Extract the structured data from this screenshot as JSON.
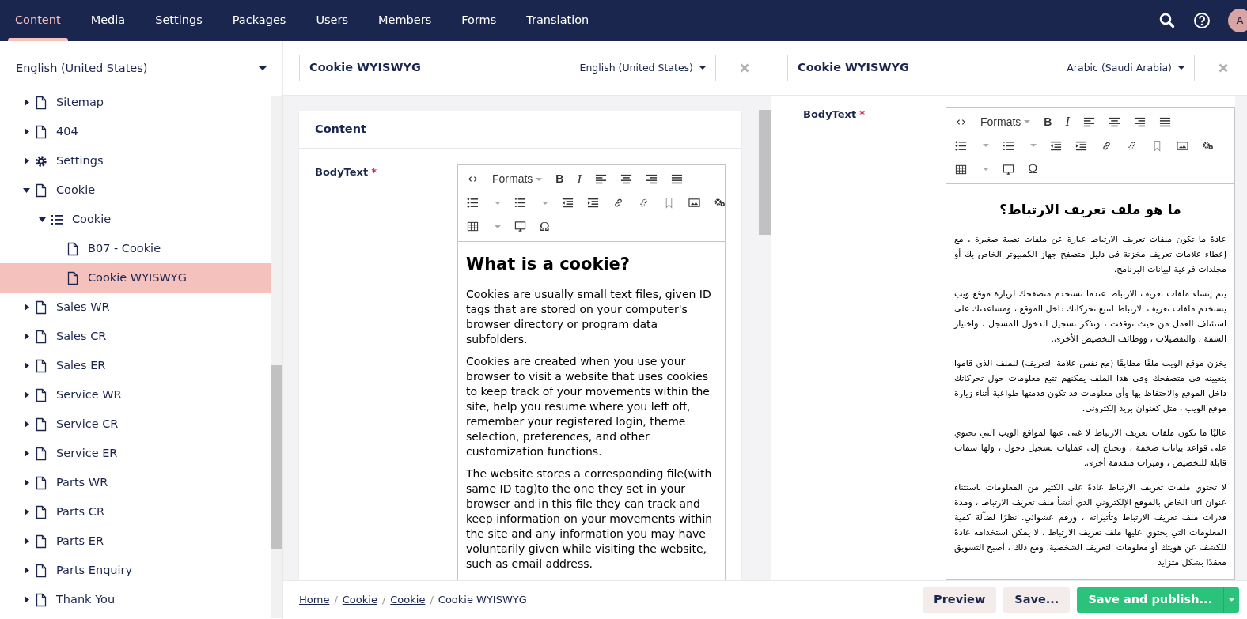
{
  "nav": {
    "tabs": [
      {
        "label": "Content",
        "selected": true
      },
      {
        "label": "Media",
        "selected": false
      },
      {
        "label": "Settings",
        "selected": false
      },
      {
        "label": "Packages",
        "selected": false
      },
      {
        "label": "Users",
        "selected": false
      },
      {
        "label": "Members",
        "selected": false
      },
      {
        "label": "Forms",
        "selected": false
      },
      {
        "label": "Translation",
        "selected": false
      }
    ],
    "avatar": "A"
  },
  "sidebar": {
    "language": "English (United States)",
    "tree": [
      {
        "label": "Sitemap",
        "kind": "page",
        "expanded": false,
        "selected": false
      },
      {
        "label": "404",
        "kind": "page",
        "expanded": false,
        "selected": false
      },
      {
        "label": "Settings",
        "kind": "settings",
        "expanded": false,
        "selected": false
      },
      {
        "label": "Cookie",
        "kind": "page",
        "expanded": true,
        "selected": false,
        "children": [
          {
            "label": "Cookie",
            "kind": "list",
            "expanded": true,
            "selected": false,
            "children": [
              {
                "label": "B07 - Cookie",
                "kind": "page",
                "selected": false
              },
              {
                "label": "Cookie WYISWYG",
                "kind": "page",
                "selected": true
              }
            ]
          }
        ]
      },
      {
        "label": "Sales WR",
        "kind": "page",
        "expanded": false,
        "selected": false
      },
      {
        "label": "Sales CR",
        "kind": "page",
        "expanded": false,
        "selected": false
      },
      {
        "label": "Sales ER",
        "kind": "page",
        "expanded": false,
        "selected": false
      },
      {
        "label": "Service WR",
        "kind": "page",
        "expanded": false,
        "selected": false
      },
      {
        "label": "Service CR",
        "kind": "page",
        "expanded": false,
        "selected": false
      },
      {
        "label": "Service ER",
        "kind": "page",
        "expanded": false,
        "selected": false
      },
      {
        "label": "Parts WR",
        "kind": "page",
        "expanded": false,
        "selected": false
      },
      {
        "label": "Parts CR",
        "kind": "page",
        "expanded": false,
        "selected": false
      },
      {
        "label": "Parts ER",
        "kind": "page",
        "expanded": false,
        "selected": false
      },
      {
        "label": "Parts Enquiry",
        "kind": "page",
        "expanded": false,
        "selected": false
      },
      {
        "label": "Thank You",
        "kind": "page",
        "expanded": false,
        "selected": false
      }
    ]
  },
  "editors": [
    {
      "name": "Cookie WYISWYG",
      "culture": "English (United States)",
      "group": "Content",
      "property": "BodyText",
      "required_mark": "*",
      "kind": "ltr",
      "toolbar": [
        [
          {
            "kind": "source"
          },
          {
            "kind": "formats",
            "label": "Formats"
          },
          {
            "kind": "bold",
            "label": "B"
          },
          {
            "kind": "italic",
            "label": "I"
          },
          {
            "kind": "align-left"
          },
          {
            "kind": "align-center"
          },
          {
            "kind": "align-right"
          },
          {
            "kind": "justify"
          }
        ],
        [
          {
            "kind": "bullet-list"
          },
          {
            "kind": "numbered-list"
          },
          {
            "kind": "outdent"
          },
          {
            "kind": "indent"
          },
          {
            "kind": "link"
          },
          {
            "kind": "unlink"
          },
          {
            "kind": "anchor"
          },
          {
            "kind": "image"
          },
          {
            "kind": "macro"
          }
        ],
        [
          {
            "kind": "table"
          },
          {
            "kind": "embed"
          },
          {
            "kind": "char",
            "label": "Ω"
          }
        ]
      ],
      "content": [
        {
          "kind": "heading",
          "text": "What is a cookie?"
        },
        {
          "kind": "paragraph",
          "text": "Cookies are usually small text files, given ID tags that are stored on your computer's browser directory or program data subfolders."
        },
        {
          "kind": "paragraph",
          "text": "Cookies are created when you use your browser to visit a website that uses cookies to keep track of your movements within the site, help you resume where you left off, remember your registered login, theme selection, preferences, and other customization functions."
        },
        {
          "kind": "paragraph",
          "text": "The website stores a corresponding file(with same ID tag)to the one they set in your browser and in this file they can track and keep information on your movements within the site and any information you may have voluntarily given while visiting the website, such as email address."
        }
      ]
    },
    {
      "name": "Cookie WYISWYG",
      "culture": "Arabic (Saudi Arabia)",
      "property": "BodyText",
      "required_mark": "*",
      "kind": "rtl",
      "toolbar": [
        [
          {
            "kind": "source"
          },
          {
            "kind": "formats",
            "label": "Formats"
          },
          {
            "kind": "bold",
            "label": "B"
          },
          {
            "kind": "italic",
            "label": "I"
          },
          {
            "kind": "align-left"
          },
          {
            "kind": "align-center"
          },
          {
            "kind": "align-right"
          },
          {
            "kind": "justify"
          }
        ],
        [
          {
            "kind": "bullet-list"
          },
          {
            "kind": "numbered-list"
          },
          {
            "kind": "outdent"
          },
          {
            "kind": "indent"
          },
          {
            "kind": "link"
          },
          {
            "kind": "unlink"
          },
          {
            "kind": "anchor"
          },
          {
            "kind": "image"
          },
          {
            "kind": "macro"
          }
        ],
        [
          {
            "kind": "table"
          },
          {
            "kind": "embed"
          },
          {
            "kind": "char",
            "label": "Ω"
          }
        ]
      ],
      "content": [
        {
          "kind": "heading",
          "text": "ما هو ملف تعريف الارتباط؟"
        },
        {
          "kind": "paragraph",
          "text": "عادةً ما تكون ملفات تعريف الارتباط عبارة عن ملفات نصية صغيرة ، مع إعطاء علامات تعريف مخزنة في دليل متصفح جهاز الكمبيوتر الخاص بك أو مجلدات فرعية لبيانات البرنامج."
        },
        {
          "kind": "paragraph",
          "text": "يتم إنشاء ملفات تعريف الارتباط عندما تستخدم متصفحك لزيارة موقع ويب يستخدم ملفات تعريف الارتباط لتتبع تحركاتك داخل الموقع ، ومساعدتك على استئناف العمل من حيث توقفت ، وتذكر تسجيل الدخول المسجل ، واختيار السمة ، والتفضيلات ، ووظائف التخصيص الأخرى."
        },
        {
          "kind": "paragraph",
          "text": "يخزن موقع الويب ملفًا مطابقًا (مع نفس علامة التعريف) للملف الذي قاموا بتعيينه في متصفحك وفي هذا الملف يمكنهم تتبع معلومات حول تحركاتك داخل الموقع والاحتفاظ بها وأي معلومات قد تكون قدمتها طواعية أثناء زيارة موقع الويب ، مثل كعنوان بريد إلكتروني."
        },
        {
          "kind": "paragraph",
          "text": "عاليًا ما تكون ملفات تعريف الارتباط لا غنى عنها لمواقع الويب التي تحتوي على قواعد بيانات ضخمة ، وتحتاج إلى عمليات تسجيل دخول ، ولها سمات قابلة للتخصيص ، وميزات متقدمة أخرى."
        },
        {
          "kind": "paragraph",
          "text": "لا تحتوي ملفات تعريف الارتباط عادةً على الكثير من المعلومات باستثناء عنوان url الخاص بالموقع الإلكتروني الذي أنشأ ملف تعريف الارتباط ، ومدة قدرات ملف تعريف الارتباط وتأثيراته ، ورقم عشوائي. نظرًا لضآلة كمية المعلومات التي يحتوي عليها ملف تعريف الارتباط ، لا يمكن استخدامه عادةً للكشف عن هويتك أو معلومات التعريف الشخصية. ومع ذلك ، أصبح التسويق معقدًا بشكل متزايد"
        }
      ]
    }
  ],
  "footer": {
    "separator": "/",
    "breadcrumbs": [
      {
        "label": "Home",
        "link": true
      },
      {
        "label": "Cookie",
        "link": true
      },
      {
        "label": "Cookie",
        "link": true
      },
      {
        "label": "Cookie WYISWYG",
        "link": false
      }
    ],
    "buttons": [
      {
        "label": "Preview",
        "kind": "secondary"
      },
      {
        "label": "Save...",
        "kind": "secondary"
      },
      {
        "label": "Save and publish...",
        "kind": "primary"
      }
    ]
  }
}
